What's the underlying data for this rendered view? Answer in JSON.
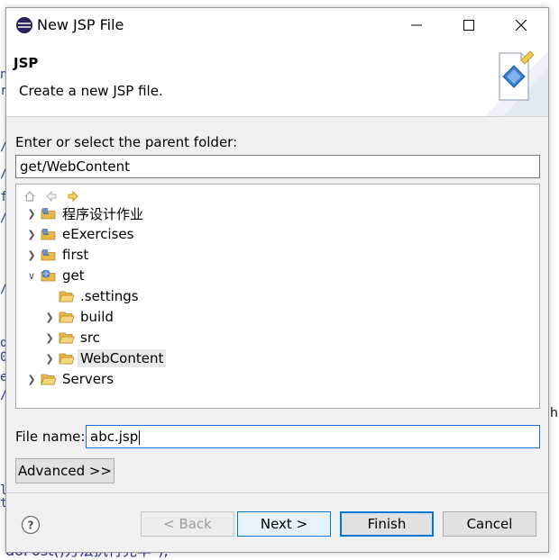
{
  "window": {
    "title": "New JSP File"
  },
  "banner": {
    "heading": "JSP",
    "description": "Create a new JSP file."
  },
  "parent_folder": {
    "label": "Enter or select the parent folder:",
    "value": "get/WebContent"
  },
  "tree": {
    "items": [
      {
        "label": "程序设计作业",
        "expanded": false,
        "type": "project"
      },
      {
        "label": "eExercises",
        "expanded": false,
        "type": "project"
      },
      {
        "label": "first",
        "expanded": false,
        "type": "project"
      },
      {
        "label": "get",
        "expanded": true,
        "type": "project"
      },
      {
        "label": ".settings",
        "expanded": false,
        "type": "folder"
      },
      {
        "label": "build",
        "expanded": false,
        "type": "folder"
      },
      {
        "label": "src",
        "expanded": false,
        "type": "folder"
      },
      {
        "label": "WebContent",
        "expanded": false,
        "type": "folder",
        "selected": true
      },
      {
        "label": "Servers",
        "expanded": false,
        "type": "folder"
      }
    ]
  },
  "file_name": {
    "label": "File name:",
    "value": "abc.jsp"
  },
  "buttons": {
    "advanced": "Advanced >>",
    "back": "< Back",
    "next": "Next >",
    "finish": "Finish",
    "cancel": "Cancel"
  },
  "background": {
    "left_fragments": [
      "n",
      "r",
      "/",
      "/",
      "f",
      "/",
      "/",
      "q",
      "0",
      "e",
      "/",
      "l",
      "t"
    ],
    "right_fragment": "h",
    "bottom_fragment": "doPost()方法执行完毕\");"
  },
  "colors": {
    "accent": "#0078d7",
    "folder": "#e8b84a",
    "selection": "#e8e8e8"
  }
}
